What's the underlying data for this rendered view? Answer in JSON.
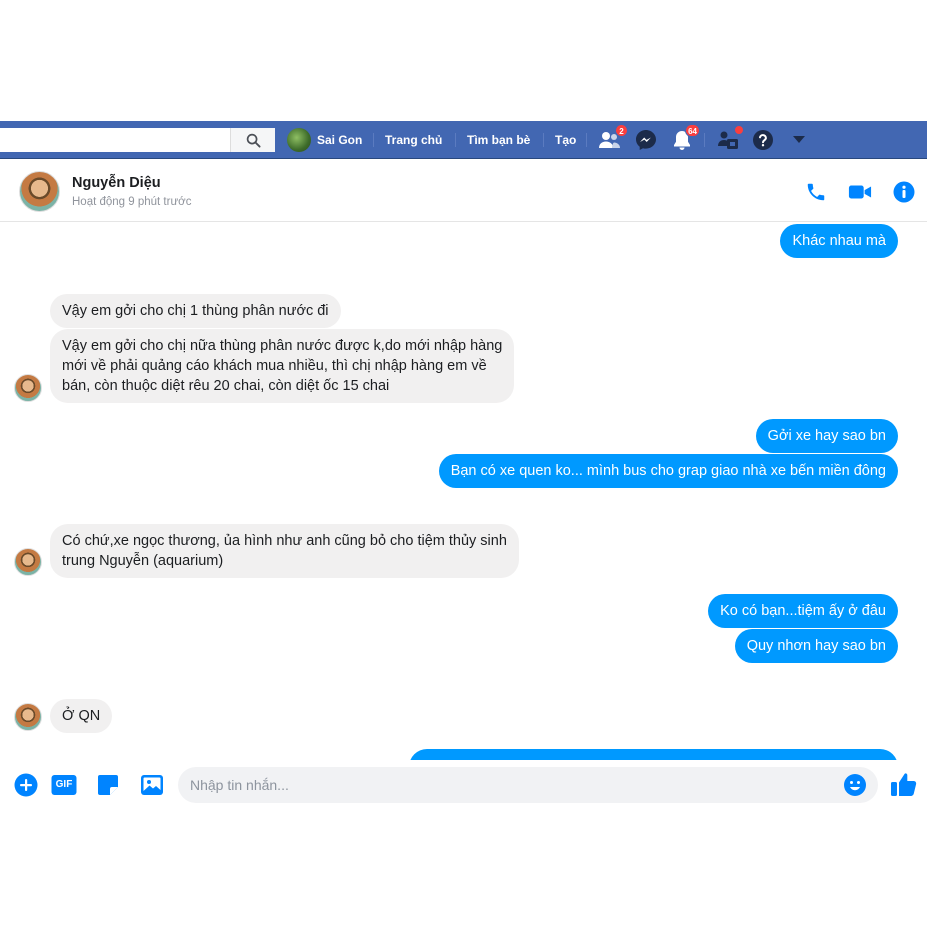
{
  "topbar": {
    "search": {
      "placeholder": ""
    },
    "profile_name": "Sai Gon",
    "nav_items": [
      "Trang chủ",
      "Tìm bạn bè",
      "Tạo"
    ],
    "friend_requests_count": "2",
    "notifications_count": "64",
    "icons": [
      "search-icon",
      "friend-requests-icon",
      "messenger-icon",
      "notifications-icon",
      "quick-help-icon",
      "help-icon",
      "caret-down-icon"
    ]
  },
  "chat_header": {
    "name": "Nguyễn Diệu",
    "status": "Hoạt động 9 phút trước",
    "actions": [
      "phone-icon",
      "video-call-icon",
      "info-icon"
    ]
  },
  "messages": [
    {
      "from": "me",
      "text": "Khác nhau mà"
    },
    {
      "from": "them",
      "text": "Vậy em gởi cho chị 1 thùng phân nước đi"
    },
    {
      "from": "them",
      "lines": [
        "Vậy em gởi cho chị nữa thùng phân nước được k,do mới nhập hàng",
        "mới về phải quảng cáo khách mua nhiều, thì chị nhập hàng em về",
        "bán, còn thuộc diệt rêu 20 chai, còn diệt ốc 15 chai"
      ]
    },
    {
      "from": "me",
      "text": "Gởi xe hay sao bn"
    },
    {
      "from": "me",
      "text": "Bạn có xe quen ko... mình bus cho grap giao nhà xe bến miền đông"
    },
    {
      "from": "them",
      "lines": [
        "Có chứ,xe ngọc thương, ủa hình như anh cũng bỏ cho tiệm thủy sinh",
        "trung Nguyễn (aquarium)"
      ]
    },
    {
      "from": "me",
      "text": "Ko có bạn...tiệm ấy ở đâu"
    },
    {
      "from": "me",
      "text": "Quy nhơn  hay sao bn"
    },
    {
      "from": "them",
      "text": "Ở QN"
    },
    {
      "from": "me",
      "text": ""
    }
  ],
  "composer": {
    "placeholder": "Nhập tin nhắn...",
    "value": "",
    "icons": [
      "add-icon",
      "gif-icon",
      "sticker-icon",
      "photo-icon",
      "emoji-icon",
      "like-icon"
    ],
    "gif_label": "GIF"
  },
  "colors": {
    "topbar": "#4267b2",
    "outgoing_bubble": "#0099ff",
    "incoming_bubble": "#f1f0f0",
    "accent": "#0084ff",
    "badge": "#fa3e3e"
  }
}
